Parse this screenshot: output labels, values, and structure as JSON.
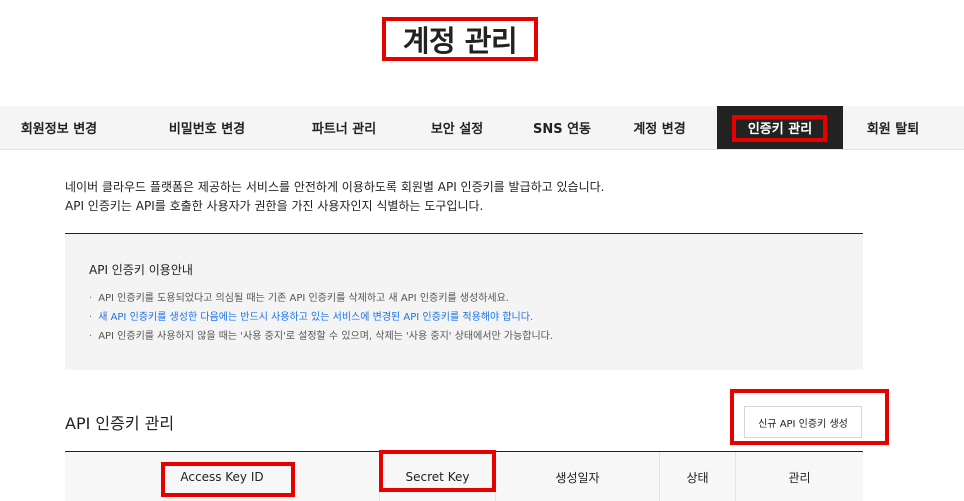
{
  "page_title": "계정 관리",
  "tabs": [
    {
      "label": "회원정보 변경",
      "active": false
    },
    {
      "label": "비밀번호 변경",
      "active": false
    },
    {
      "label": "파트너 관리",
      "active": false
    },
    {
      "label": "보안 설정",
      "active": false
    },
    {
      "label": "SNS 연동",
      "active": false
    },
    {
      "label": "계정 변경",
      "active": false
    },
    {
      "label": "인증키 관리",
      "active": true
    },
    {
      "label": "회원 탈퇴",
      "active": false
    }
  ],
  "intro": {
    "line1": "네이버 클라우드 플랫폼은 제공하는 서비스를 안전하게 이용하도록 회원별 API 인증키를 발급하고 있습니다.",
    "line2": "API 인증키는 API를 호출한 사용자가 권한을 가진 사용자인지 식별하는 도구입니다."
  },
  "guide": {
    "title": "API 인증키 이용안내",
    "items": [
      "API 인증키를 도용되었다고 의심될 때는 기존 API 인증키를 삭제하고 새 API 인증키를 생성하세요.",
      "새 API 인증키를 생성한 다음에는 반드시 사용하고 있는 서비스에 변경된 API 인증키를 적용해야 합니다.",
      "API 인증키를 사용하지 않을 때는 '사용 중지'로 설정할 수 있으며, 삭제는 '사용 중지' 상태에서만 가능합니다."
    ]
  },
  "section_title": "API 인증키 관리",
  "new_key_button": "신규 API 인증키 생성",
  "table": {
    "columns": [
      "Access Key ID",
      "Secret Key",
      "생성일자",
      "상태",
      "관리"
    ]
  },
  "colors": {
    "highlight": "#e60000",
    "active_tab_bg": "#222222",
    "guide_link": "#1a73e8"
  }
}
